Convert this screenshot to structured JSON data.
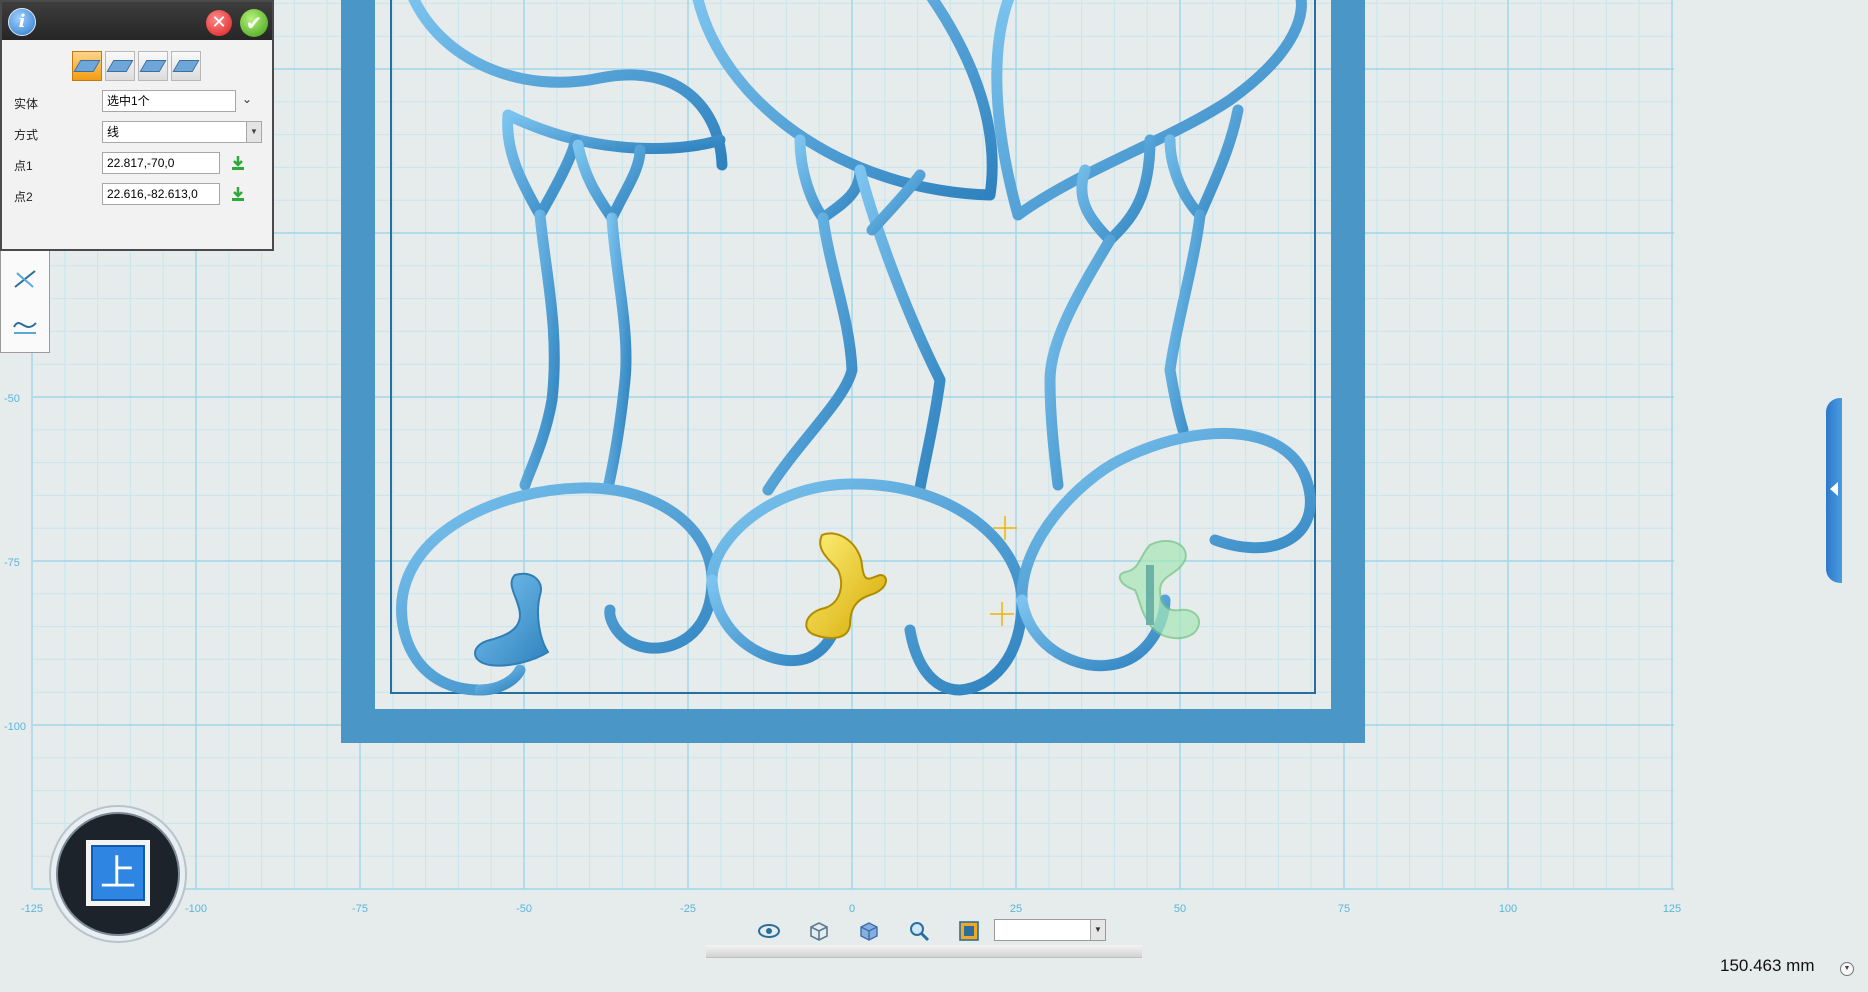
{
  "panel": {
    "info_icon": "info-icon",
    "close_icon": "close-icon",
    "confirm_icon": "check-icon",
    "modes": [
      "extrude-mode-icon",
      "split-mode-icon",
      "cut-mode-icon",
      "emboss-mode-icon"
    ],
    "entity_label": "实体",
    "entity_value": "选中1个",
    "method_label": "方式",
    "method_value": "线",
    "point1_label": "点1",
    "point1_value": "22.817,-70,0",
    "point2_label": "点2",
    "point2_value": "22.616,-82.613,0"
  },
  "side_tools": [
    "line-split-icon",
    "curve-split-icon"
  ],
  "grid": {
    "x_ticks": [
      "-125",
      "-100",
      "-75",
      "-50",
      "-25",
      "0",
      "25",
      "50",
      "75",
      "100",
      "125"
    ],
    "y_ticks": [
      "-50",
      "-75",
      "-100"
    ]
  },
  "view_cube": {
    "label": "上"
  },
  "bottom_toolbar": {
    "icons": [
      "eye-icon",
      "wireframe-cube-icon",
      "solid-cube-icon",
      "zoom-icon",
      "fit-view-icon"
    ],
    "select_value": ""
  },
  "measurement": "150.463 mm",
  "colors": {
    "model": "#4a9fd8",
    "frame": "#4a96c6",
    "highlight": "#f2d024",
    "ghost": "#9be0a8",
    "grid": "#9fd6e8"
  }
}
